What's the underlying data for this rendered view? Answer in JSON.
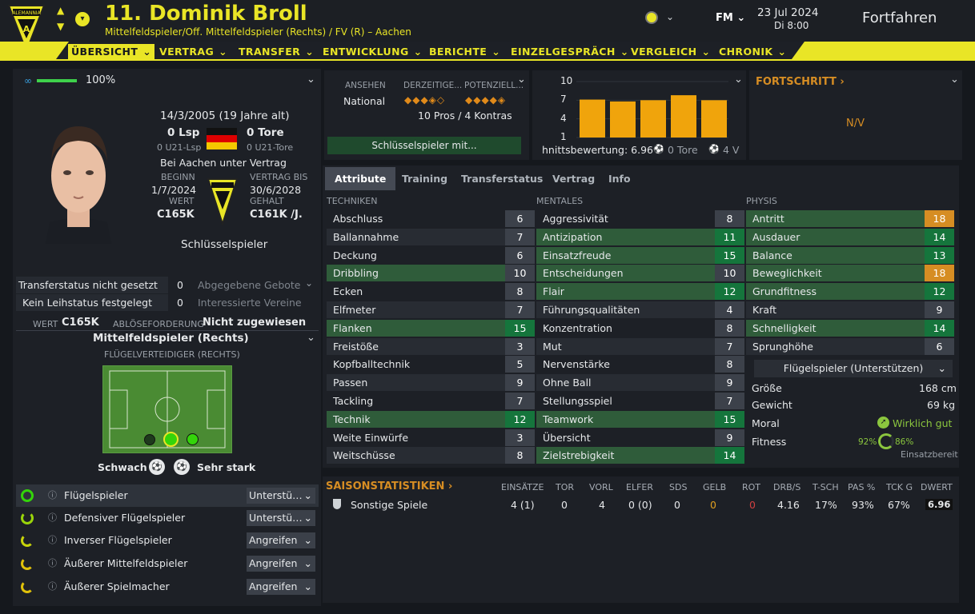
{
  "header": {
    "player_title": "11. Dominik Broll",
    "player_subtitle": "Mittelfeldspieler/Off. Mittelfeldspieler (Rechts) / FV (R) – Aachen",
    "fm_label": "FM",
    "date": "23 Jul 2024",
    "day_time": "Di 8:00",
    "continue_label": "Fortfahren",
    "club_logo_text": "ALEMANNIA"
  },
  "nav": [
    {
      "label": "ÜBERSICHT",
      "active": true
    },
    {
      "label": "VERTRAG"
    },
    {
      "label": "TRANSFER"
    },
    {
      "label": "ENTWICKLUNG"
    },
    {
      "label": "BERICHTE"
    },
    {
      "label": "EINZELGESPRÄCH"
    },
    {
      "label": "VERGLEICH"
    },
    {
      "label": "CHRONIK"
    }
  ],
  "profile": {
    "familiarity": "100%",
    "familiarity_fraction": 1.0,
    "dob": "14/3/2005 (19 Jahre alt)",
    "caps": "0 Lsp",
    "goals": "0 Tore",
    "u21_caps": "0 U21-Lsp",
    "u21_goals": "0 U21-Tore",
    "contract_text": "Bei Aachen unter Vertrag",
    "beginn_label": "BEGINN",
    "beginn": "1/7/2024",
    "vertrag_label": "VERTRAG BIS",
    "vertrag_bis": "30/6/2028",
    "wert_label": "WERT",
    "wert": "C165K",
    "gehalt_label": "GEHALT",
    "gehalt": "C161K /J.",
    "squad_status": "Schlüsselspieler"
  },
  "transfer": {
    "status": "Transferstatus nicht gesetzt",
    "bids_count": "0",
    "bids_label": "Abgegebene Gebote",
    "loan": "Kein Leihstatus festgelegt",
    "interest_count": "0",
    "interest_label": "Interessierte Vereine",
    "wert_label": "WERT",
    "wert": "C165K",
    "abl_label": "ABLÖSEFORDERUNG",
    "abl": "Nicht zugewiesen"
  },
  "position": {
    "title": "Mittelfeldspieler (Rechts)",
    "subtitle": "FLÜGELVERTEIDIGER (RECHTS)",
    "weak_label": "Schwach",
    "strong_label": "Sehr stark"
  },
  "roles": [
    {
      "name": "Flügelspieler",
      "duty": "Unterstü…"
    },
    {
      "name": "Defensiver Flügelspieler",
      "duty": "Unterstü…"
    },
    {
      "name": "Inverser Flügelspieler",
      "duty": "Angreifen"
    },
    {
      "name": "Äußerer Mittelfeldspieler",
      "duty": "Angreifen"
    },
    {
      "name": "Äußerer Spielmacher",
      "duty": "Angreifen"
    }
  ],
  "reputation": {
    "ansehen_label": "ANSEHEN",
    "ansehen": "National",
    "current_label": "DERZEITIGE...",
    "potential_label": "POTENZIELL...",
    "current_stars": 3.5,
    "potential_stars": 4.5,
    "pros_cons": "10 Pros / 4 Kontras",
    "key_button": "Schlüsselspieler mit..."
  },
  "ratings_chart": {
    "type": "bar",
    "y_ticks": [
      "10",
      "7",
      "4",
      "1"
    ],
    "ylim": [
      1,
      10
    ],
    "values": [
      7.1,
      6.8,
      7.0,
      7.8,
      7.0
    ],
    "summary": "hnittsbewertung: 6.96",
    "goals": "0 Tore",
    "assists": "4 V"
  },
  "chart_data": {
    "type": "bar",
    "values": [
      7.1,
      6.8,
      7.0,
      7.8,
      7.0
    ],
    "ylim": [
      1,
      10
    ],
    "y_ticks": [
      10,
      7,
      4,
      1
    ],
    "xlabel": "",
    "ylabel": ""
  },
  "progress": {
    "title": "FORTSCHRITT",
    "value": "N/V"
  },
  "tabs": [
    "Attribute",
    "Training",
    "Transferstatus",
    "Vertrag",
    "Info"
  ],
  "attributes": {
    "tech_label": "TECHNIKEN",
    "mental_label": "MENTALES",
    "phys_label": "PHYSIS",
    "technical": [
      {
        "name": "Abschluss",
        "value": "6"
      },
      {
        "name": "Ballannahme",
        "value": "7"
      },
      {
        "name": "Deckung",
        "value": "6"
      },
      {
        "name": "Dribbling",
        "value": "10"
      },
      {
        "name": "Ecken",
        "value": "8"
      },
      {
        "name": "Elfmeter",
        "value": "7"
      },
      {
        "name": "Flanken",
        "value": "15"
      },
      {
        "name": "Freistöße",
        "value": "3"
      },
      {
        "name": "Kopfballtechnik",
        "value": "5"
      },
      {
        "name": "Passen",
        "value": "9"
      },
      {
        "name": "Tackling",
        "value": "7"
      },
      {
        "name": "Technik",
        "value": "12"
      },
      {
        "name": "Weite Einwürfe",
        "value": "3"
      },
      {
        "name": "Weitschüsse",
        "value": "8"
      }
    ],
    "mental": [
      {
        "name": "Aggressivität",
        "value": "8"
      },
      {
        "name": "Antizipation",
        "value": "11"
      },
      {
        "name": "Einsatzfreude",
        "value": "15"
      },
      {
        "name": "Entscheidungen",
        "value": "10"
      },
      {
        "name": "Flair",
        "value": "12"
      },
      {
        "name": "Führungsqualitäten",
        "value": "4"
      },
      {
        "name": "Konzentration",
        "value": "8"
      },
      {
        "name": "Mut",
        "value": "7"
      },
      {
        "name": "Nervenstärke",
        "value": "8"
      },
      {
        "name": "Ohne Ball",
        "value": "9"
      },
      {
        "name": "Stellungsspiel",
        "value": "7"
      },
      {
        "name": "Teamwork",
        "value": "15"
      },
      {
        "name": "Übersicht",
        "value": "9"
      },
      {
        "name": "Zielstrebigkeit",
        "value": "14"
      }
    ],
    "physical": [
      {
        "name": "Antritt",
        "value": "18"
      },
      {
        "name": "Ausdauer",
        "value": "14"
      },
      {
        "name": "Balance",
        "value": "13"
      },
      {
        "name": "Beweglichkeit",
        "value": "18"
      },
      {
        "name": "Grundfitness",
        "value": "12"
      },
      {
        "name": "Kraft",
        "value": "9"
      },
      {
        "name": "Schnelligkeit",
        "value": "14"
      },
      {
        "name": "Sprunghöhe",
        "value": "6"
      }
    ],
    "role_select": "Flügelspieler (Unterstützen)",
    "groesse_label": "Größe",
    "groesse": "168 cm",
    "gewicht_label": "Gewicht",
    "gewicht": "69 kg",
    "moral_label": "Moral",
    "moral": "Wirklich gut",
    "fitness_label": "Fitness",
    "fitness_pct": "92%",
    "sharpness_pct": "86%",
    "einsatzbereit": "Einsatzbereit"
  },
  "season": {
    "title": "SAISONSTATISTIKEN",
    "columns": [
      "EINSÄTZE",
      "TOR",
      "VORL",
      "ELFER",
      "SDS",
      "GELB",
      "ROT",
      "DRB/S",
      "T-SCH",
      "PAS %",
      "TCK G",
      "DWERT"
    ],
    "row": {
      "label": "Sonstige Spiele",
      "values": [
        "4 (1)",
        "0",
        "4",
        "0 (0)",
        "0",
        "0",
        "0",
        "4.16",
        "17%",
        "93%",
        "67%",
        "6.96"
      ]
    }
  },
  "colors": {
    "accent": "#e9e526",
    "green": "#15753c",
    "orange": "#d68d23",
    "bar": "#f0a40c"
  }
}
